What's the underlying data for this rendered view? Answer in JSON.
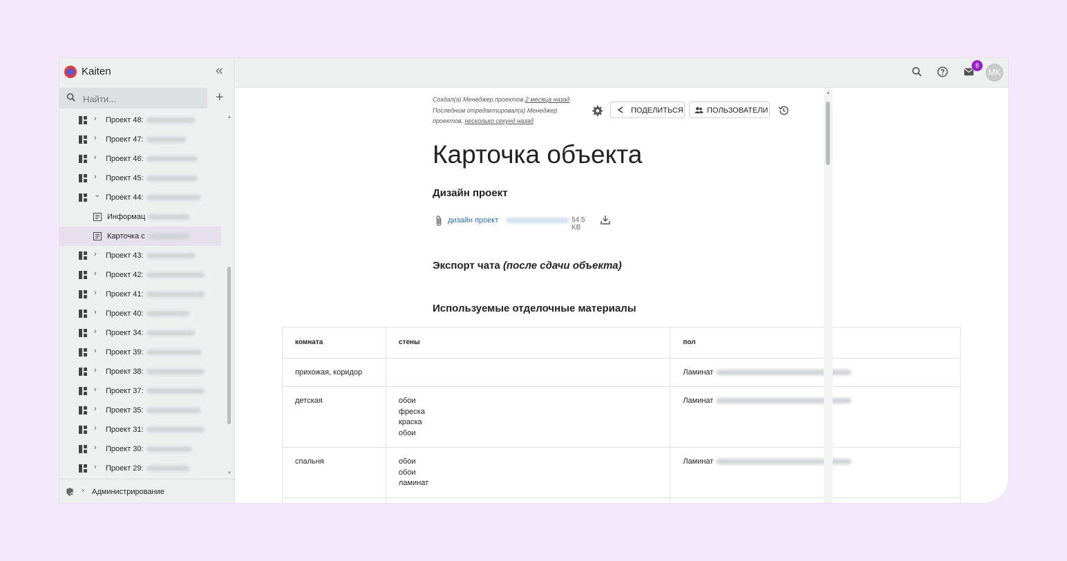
{
  "app": {
    "name": "Kaiten"
  },
  "sidebar": {
    "search_placeholder": "Найти...",
    "items": [
      {
        "label": "Проект 48:",
        "type": "board",
        "expanded": false
      },
      {
        "label": "Проект 47:",
        "type": "board",
        "expanded": false
      },
      {
        "label": "Проект 46:",
        "type": "board",
        "expanded": false
      },
      {
        "label": "Проект 45:",
        "type": "board",
        "expanded": false
      },
      {
        "label": "Проект 44:",
        "type": "board",
        "expanded": true
      },
      {
        "label": "Информац",
        "type": "document"
      },
      {
        "label": "Карточка с",
        "type": "document",
        "active": true
      },
      {
        "label": "Проект 43:",
        "type": "board",
        "expanded": false
      },
      {
        "label": "Проект 42:",
        "type": "board",
        "expanded": false
      },
      {
        "label": "Проект 41:",
        "type": "board",
        "expanded": false
      },
      {
        "label": "Проект 40:",
        "type": "board",
        "expanded": false
      },
      {
        "label": "Проект 34:",
        "type": "board",
        "expanded": false
      },
      {
        "label": "Проект 39:",
        "type": "board",
        "expanded": false
      },
      {
        "label": "Проект 38:",
        "type": "board",
        "expanded": false
      },
      {
        "label": "Проект 37:",
        "type": "board",
        "expanded": false
      },
      {
        "label": "Проект 35:",
        "type": "board",
        "expanded": false
      },
      {
        "label": "Проект 31:",
        "type": "board",
        "expanded": false
      },
      {
        "label": "Проект 30:",
        "type": "board",
        "expanded": false
      },
      {
        "label": "Проект 29:",
        "type": "board",
        "expanded": false
      }
    ],
    "admin_label": "Администрирование"
  },
  "header": {
    "notifications_count": "8",
    "avatar_initials": "MK"
  },
  "document": {
    "meta_created_prefix": "Создал(а) Менеджер проектов",
    "meta_created_when": "2 месяца назад",
    "meta_edited_prefix": "Последним отредактировал(а) Менеджер проектов,",
    "meta_edited_when": "несколько секунд назад",
    "share_label": "ПОДЕЛИТЬСЯ",
    "users_label": "ПОЛЬЗОВАТЕЛИ",
    "title": "Карточка объекта",
    "design_heading": "Дизайн проект",
    "attachment_name": "дизайн проект",
    "attachment_size": "54.5 KB",
    "export_heading_plain": "Экспорт чата ",
    "export_heading_italic": "(после сдачи объекта)",
    "materials_heading": "Используемые отделочные материалы",
    "table": {
      "headers": [
        "комната",
        "стены",
        "пол"
      ],
      "rows": [
        {
          "room": "прихожая, коридор",
          "walls": [],
          "floor": "Ламинат"
        },
        {
          "room": "детская",
          "walls": [
            "обои",
            "фреска",
            "краска",
            "обои"
          ],
          "floor": "Ламинат"
        },
        {
          "room": "спальня",
          "walls": [
            "обои",
            "обои",
            "ламинат"
          ],
          "floor": "Ламинат"
        }
      ]
    }
  },
  "colors": {
    "page_bg": "#f3e8fc",
    "badge": "#9a22c9",
    "link": "#2a6fb3"
  }
}
